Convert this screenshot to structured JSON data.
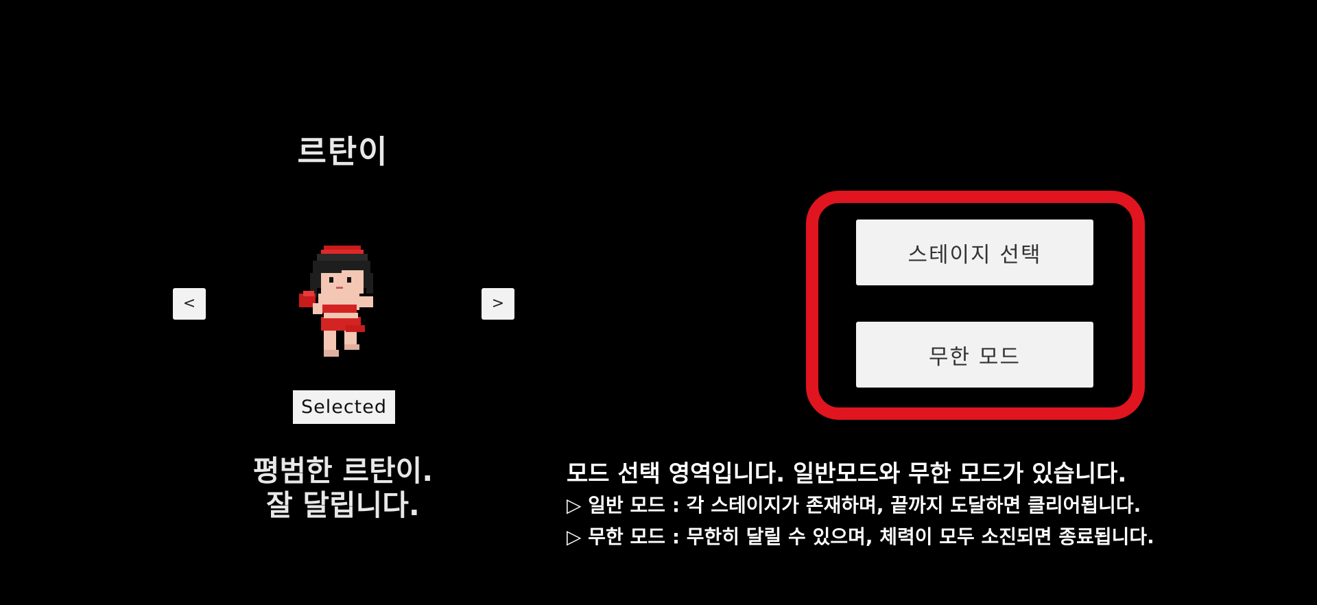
{
  "character": {
    "name": "르탄이",
    "prev_label": "<",
    "next_label": ">",
    "selected_label": "Selected",
    "description_line1": "평범한 르탄이.",
    "description_line2": "잘 달립니다."
  },
  "modes": {
    "stage_select_label": "스테이지 선택",
    "endless_mode_label": "무한 모드",
    "highlight_color": "#e0151f"
  },
  "mode_info": {
    "line1": "모드 선택 영역입니다. 일반모드와 무한 모드가 있습니다.",
    "line2": "▷ 일반 모드 : 각 스테이지가 존재하며, 끝까지 도달하면 클리어됩니다.",
    "line3": "▷ 무한 모드 : 무한히 달릴 수 있으며, 체력이 모두 소진되면 종료됩니다."
  }
}
